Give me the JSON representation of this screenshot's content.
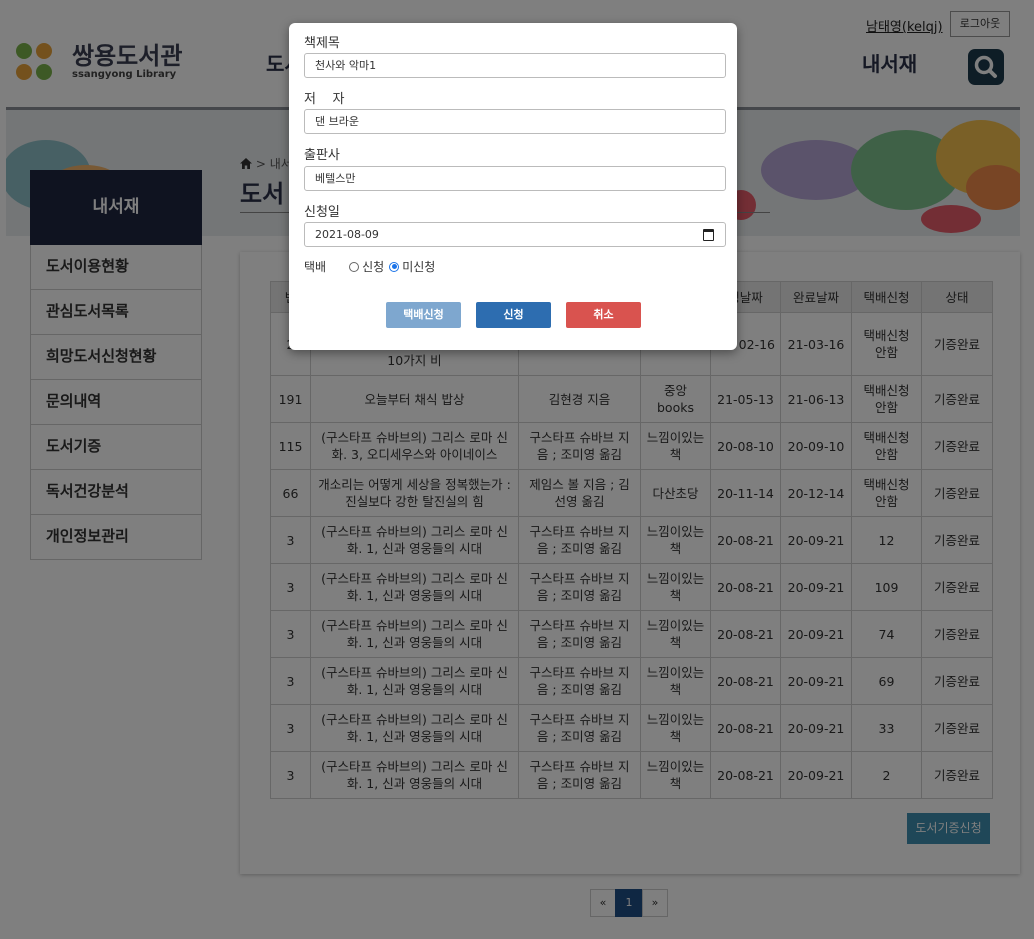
{
  "header": {
    "logo_title": "쌍용도서관",
    "logo_sub": "ssangyong Library",
    "nav_cut": "도서",
    "nav_my": "내서재",
    "user": "남태영(kelqj)",
    "logout": "로그아웃",
    "search_icon": "search-icon"
  },
  "breadcrumb": {
    "home_icon": "home-icon",
    "text": "> 내서"
  },
  "page_title": "도서",
  "sidebar": {
    "title": "내서재",
    "items": [
      "도서이용현황",
      "관심도서목록",
      "희망도서신청현황",
      "문의내역",
      "도서기증",
      "독서건강분석",
      "개인정보관리"
    ]
  },
  "table": {
    "headers": [
      "번",
      "",
      "",
      "",
      "청날짜",
      "완료날짜",
      "택배신청",
      "상태"
    ],
    "rows": [
      [
        "2",
        "10가지 비",
        "",
        "",
        "02-16",
        "21-03-16",
        "택배신청 안함",
        "기증완료"
      ],
      [
        "191",
        "오늘부터 채식 밥상",
        "김현경 지음",
        "중앙books",
        "21-05-13",
        "21-06-13",
        "택배신청 안함",
        "기증완료"
      ],
      [
        "115",
        "(구스타프 슈바브의) 그리스 로마 신화. 3, 오디세우스와 아이네이스",
        "구스타프 슈바브 지음 ; 조미영 옮김",
        "느낌이있는책",
        "20-08-10",
        "20-09-10",
        "택배신청 안함",
        "기증완료"
      ],
      [
        "66",
        "개소리는 어떻게 세상을 정복했는가 : 진실보다 강한 탈진실의 힘",
        "제임스 볼 지음 ; 김선영 옮김",
        "다산초당",
        "20-11-14",
        "20-12-14",
        "택배신청 안함",
        "기증완료"
      ],
      [
        "3",
        "(구스타프 슈바브의) 그리스 로마 신화. 1, 신과 영웅들의 시대",
        "구스타프 슈바브 지음 ; 조미영 옮김",
        "느낌이있는책",
        "20-08-21",
        "20-09-21",
        "12",
        "기증완료"
      ],
      [
        "3",
        "(구스타프 슈바브의) 그리스 로마 신화. 1, 신과 영웅들의 시대",
        "구스타프 슈바브 지음 ; 조미영 옮김",
        "느낌이있는책",
        "20-08-21",
        "20-09-21",
        "109",
        "기증완료"
      ],
      [
        "3",
        "(구스타프 슈바브의) 그리스 로마 신화. 1, 신과 영웅들의 시대",
        "구스타프 슈바브 지음 ; 조미영 옮김",
        "느낌이있는책",
        "20-08-21",
        "20-09-21",
        "74",
        "기증완료"
      ],
      [
        "3",
        "(구스타프 슈바브의) 그리스 로마 신화. 1, 신과 영웅들의 시대",
        "구스타프 슈바브 지음 ; 조미영 옮김",
        "느낌이있는책",
        "20-08-21",
        "20-09-21",
        "69",
        "기증완료"
      ],
      [
        "3",
        "(구스타프 슈바브의) 그리스 로마 신화. 1, 신과 영웅들의 시대",
        "구스타프 슈바브 지음 ; 조미영 옮김",
        "느낌이있는책",
        "20-08-21",
        "20-09-21",
        "33",
        "기증완료"
      ],
      [
        "3",
        "(구스타프 슈바브의) 그리스 로마 신화. 1, 신과 영웅들의 시대",
        "구스타프 슈바브 지음 ; 조미영 옮김",
        "느낌이있는책",
        "20-08-21",
        "20-09-21",
        "2",
        "기증완료"
      ]
    ]
  },
  "donate_button": "도서기증신청",
  "pagination": {
    "prev": "«",
    "current": "1",
    "next": "»"
  },
  "modal": {
    "title_label": "책제목",
    "title_value": "천사와 악마1",
    "author_label": "저    자",
    "author_value": "댄 브라운",
    "publisher_label": "출판사",
    "publisher_value": "베텔스만",
    "date_label": "신청일",
    "date_value": "2021-08-09",
    "delivery_label": "택배",
    "opt_apply": "신청",
    "opt_not": "미신청",
    "btn_delivery": "택배신청",
    "btn_apply": "신청",
    "btn_cancel": "취소"
  },
  "colors": {
    "navy": "#1e2640",
    "btn_delivery": "#7ea7cf",
    "btn_apply": "#2d6db0",
    "btn_cancel": "#d9534f",
    "donate": "#3e8fb0"
  }
}
